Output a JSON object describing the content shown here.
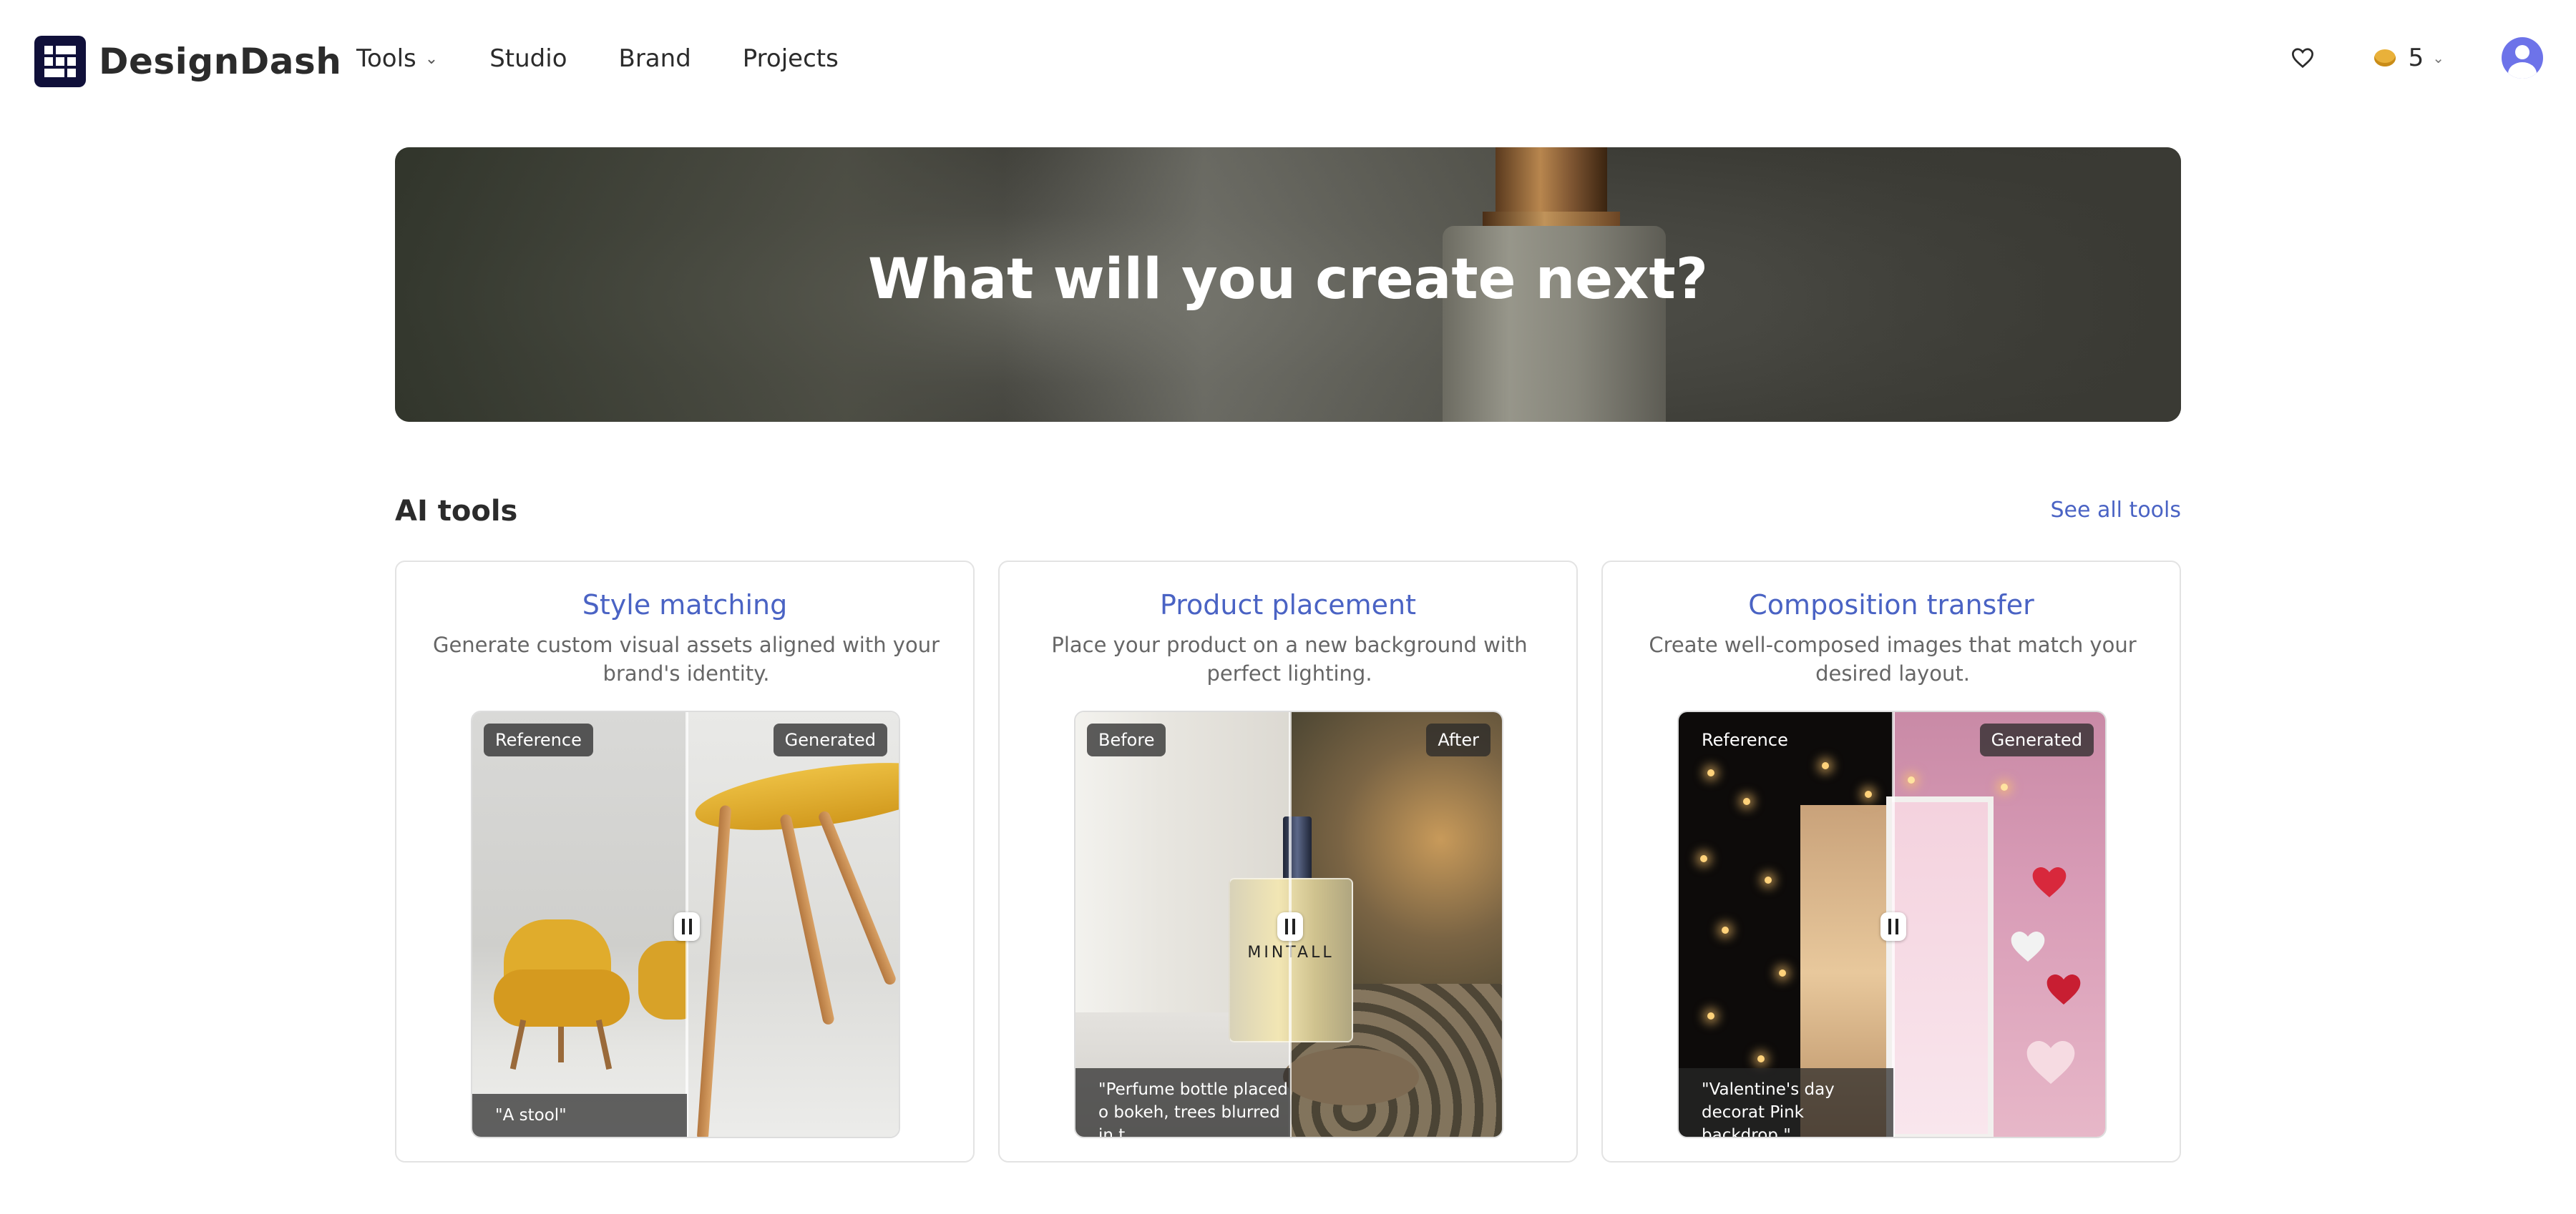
{
  "brand": {
    "name": "DesignDash"
  },
  "nav": {
    "tools": "Tools",
    "studio": "Studio",
    "brand": "Brand",
    "projects": "Projects"
  },
  "header": {
    "credits": "5"
  },
  "hero": {
    "title": "What will you create next?"
  },
  "section": {
    "title": "AI tools",
    "see_all": "See all tools"
  },
  "cards": [
    {
      "title": "Style matching",
      "description": "Generate custom visual assets aligned with your brand's identity.",
      "left_tag": "Reference",
      "right_tag": "Generated",
      "caption": "\"A stool\""
    },
    {
      "title": "Product placement",
      "description": "Place your product on a new background with perfect lighting.",
      "left_tag": "Before",
      "right_tag": "After",
      "caption": "\"Perfume bottle placed o bokeh, trees blurred in t",
      "product_label": "MINTALL"
    },
    {
      "title": "Composition transfer",
      "description": "Create well-composed images that match your desired layout.",
      "left_tag": "Reference",
      "right_tag": "Generated",
      "caption": "\"Valentine's day decorat Pink backdrop.\""
    }
  ],
  "colors": {
    "accent": "#4a63c4",
    "avatar": "#6d73e9",
    "coin": "#e9b13a",
    "logo": "#10103a"
  }
}
